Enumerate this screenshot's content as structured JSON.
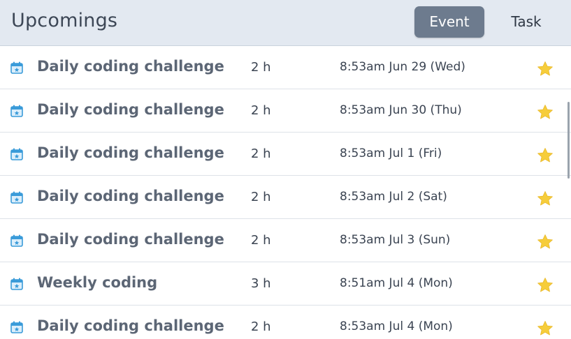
{
  "header": {
    "title": "Upcomings",
    "tabs": [
      {
        "label": "Event",
        "active": true
      },
      {
        "label": "Task",
        "active": false
      }
    ]
  },
  "icons": {
    "row_icon": "calendar-star-icon",
    "favorite_icon": "star-icon"
  },
  "colors": {
    "header_bg": "#e3e9f1",
    "active_tab_bg": "#6d7b8e",
    "calendar_icon": "#3a9bd9",
    "star": "#f6cd3b"
  },
  "events": [
    {
      "title": "Daily coding challenge",
      "duration": "2 h",
      "datetime": "8:53am Jun 29 (Wed)"
    },
    {
      "title": "Daily coding challenge",
      "duration": "2 h",
      "datetime": "8:53am Jun 30 (Thu)"
    },
    {
      "title": "Daily coding challenge",
      "duration": "2 h",
      "datetime": "8:53am Jul 1 (Fri)"
    },
    {
      "title": "Daily coding challenge",
      "duration": "2 h",
      "datetime": "8:53am Jul 2 (Sat)"
    },
    {
      "title": "Daily coding challenge",
      "duration": "2 h",
      "datetime": "8:53am Jul 3 (Sun)"
    },
    {
      "title": "Weekly coding",
      "duration": "3 h",
      "datetime": "8:51am Jul 4 (Mon)"
    },
    {
      "title": "Daily coding challenge",
      "duration": "2 h",
      "datetime": "8:53am Jul 4 (Mon)"
    }
  ]
}
